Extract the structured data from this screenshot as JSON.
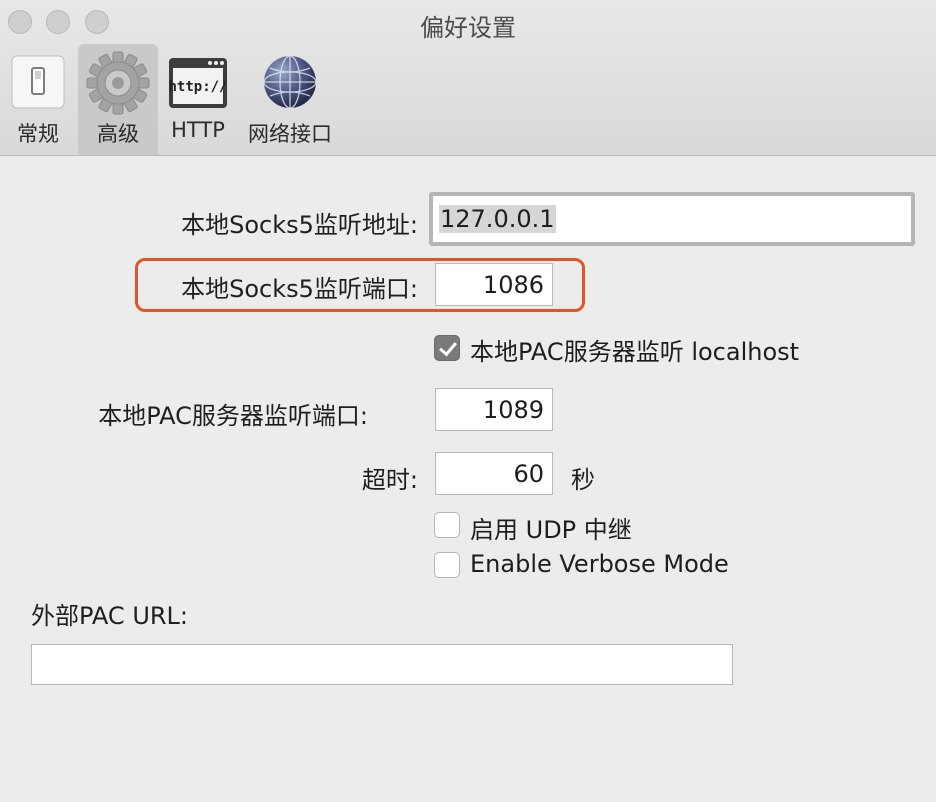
{
  "window": {
    "title": "偏好设置"
  },
  "toolbar": {
    "items": [
      {
        "label": "常规",
        "icon": "switch-icon"
      },
      {
        "label": "高级",
        "icon": "gear-icon"
      },
      {
        "label": "HTTP",
        "icon": "http-window-icon",
        "icon_text": "http://"
      },
      {
        "label": "网络接口",
        "icon": "globe-icon"
      }
    ],
    "selected": "高级"
  },
  "form": {
    "socks5_address": {
      "label": "本地Socks5监听地址:",
      "value": "127.0.0.1"
    },
    "socks5_port": {
      "label": "本地Socks5监听端口:",
      "value": "1086"
    },
    "pac_localhost": {
      "label": "本地PAC服务器监听 localhost",
      "checked": true
    },
    "pac_port": {
      "label": "本地PAC服务器监听端口:",
      "value": "1089"
    },
    "timeout": {
      "label": "超时:",
      "value": "60",
      "unit": "秒"
    },
    "udp_relay": {
      "label": "启用 UDP 中继",
      "checked": false
    },
    "verbose": {
      "label": "Enable Verbose Mode",
      "checked": false
    },
    "external_pac": {
      "label": "外部PAC URL:",
      "value": ""
    }
  },
  "annotation": {
    "color": "#e4532a"
  }
}
